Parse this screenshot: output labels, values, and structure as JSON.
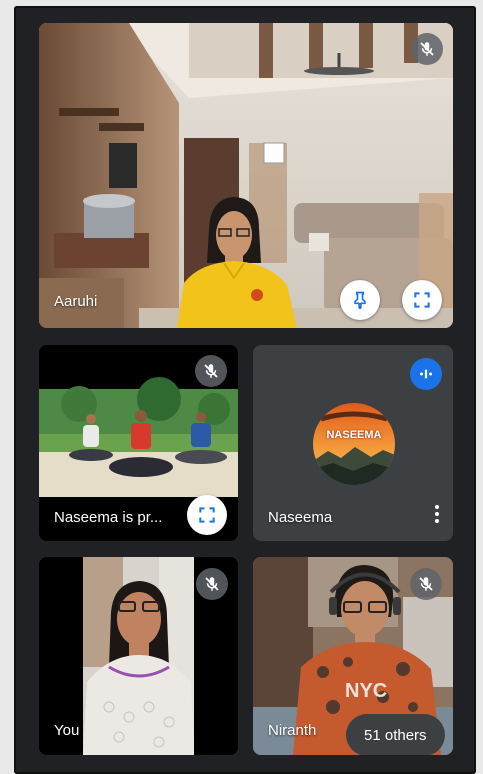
{
  "participants": {
    "main": {
      "name": "Aaruhi"
    },
    "presenting": {
      "name": "Naseema is pr..."
    },
    "naseema": {
      "name": "Naseema",
      "avatar_text": "NASEEMA"
    },
    "you": {
      "name": "You"
    },
    "niranth": {
      "name": "Niranth"
    }
  },
  "others_pill": "51 others",
  "icons": {
    "mic_off": "mic-off-icon",
    "pin": "pin-icon",
    "fullscreen": "fullscreen-icon",
    "speaking": "speaking-indicator-icon",
    "more": "more-vert-icon"
  },
  "colors": {
    "background": "#202124",
    "tile": "#3c4043",
    "accent": "#1a73e8"
  }
}
